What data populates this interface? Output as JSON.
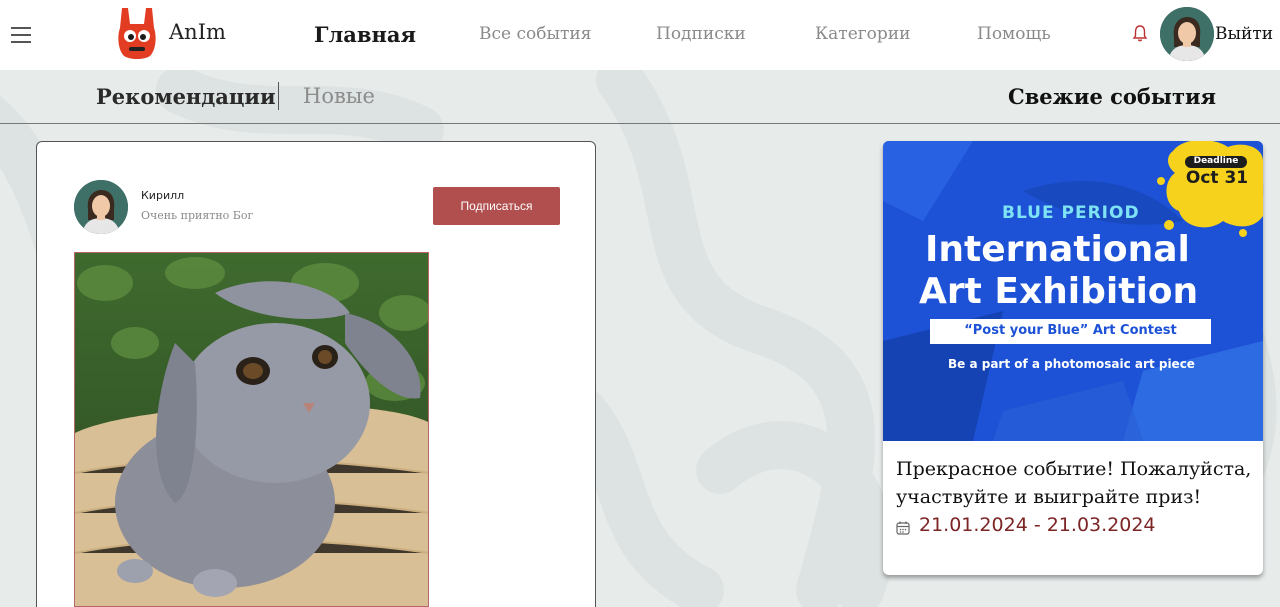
{
  "app": {
    "brand": "AnIm"
  },
  "nav": {
    "home": "Главная",
    "all_events": "Все события",
    "subscriptions": "Подписки",
    "categories": "Категории",
    "help": "Помощь",
    "logout": "Выйти"
  },
  "subnav": {
    "recommendations": "Рекомендации",
    "new": "Новые",
    "fresh_events": "Свежие события"
  },
  "post": {
    "author": "Кирилл",
    "status": "Очень приятно Бог",
    "subscribe_label": "Подписаться"
  },
  "event": {
    "banner": {
      "deadline_label": "Deadline",
      "deadline_date": "Oct 31",
      "brand": "BLUE PERIOD",
      "title_line1": "International",
      "title_line2": "Art Exhibition",
      "contest": "“Post your Blue” Art Contest",
      "tagline": "Be a part of a photomosaic art piece"
    },
    "description": "Прекрасное событие! Пожалуйста, участвуйте и выиграйте приз!",
    "dates": "21.01.2024 - 21.03.2024"
  },
  "colors": {
    "accent_button": "#b14e4e",
    "date_text": "#7c2525",
    "background": "#e7eceb",
    "banner_blue": "#1d52d6",
    "deadline_yellow": "#f6d21c"
  },
  "icons": [
    "menu-icon",
    "logo-icon",
    "bell-icon",
    "user-avatar",
    "calendar-icon"
  ]
}
